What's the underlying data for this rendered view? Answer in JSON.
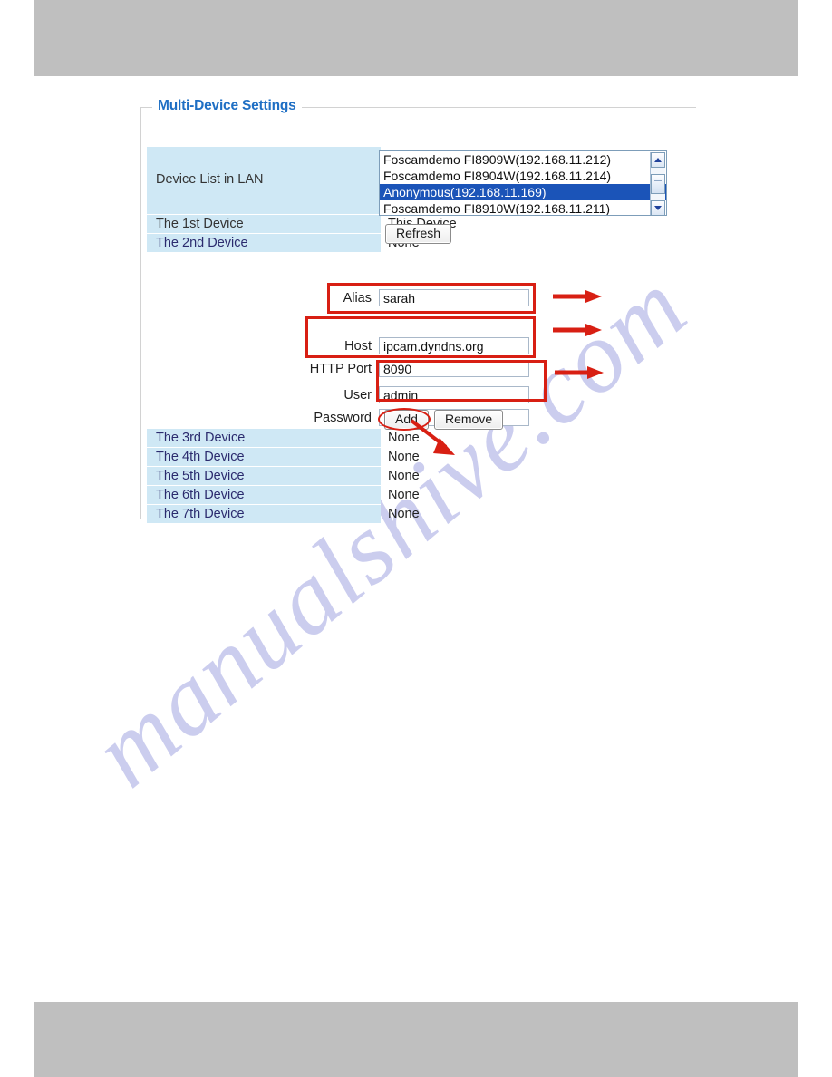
{
  "page": {
    "watermark": "manualshive.com",
    "bar_color": "#bfbfbf",
    "accent_color": "#1f6fc4",
    "annotation_color": "#d81f13",
    "row_color": "#cfe8f5"
  },
  "panel": {
    "legend": "Multi-Device Settings"
  },
  "device_list": {
    "label": "Device List in LAN",
    "options": [
      "Foscamdemo FI8909W(192.168.11.212)",
      "Foscamdemo FI8904W(192.168.11.214)",
      "Anonymous(192.168.11.169)",
      "Foscamdemo FI8910W(192.168.11.211)"
    ],
    "selected_index": 2,
    "scroll_up_icon": "chevron-up-icon",
    "scroll_down_icon": "chevron-down-icon",
    "refresh_label": "Refresh"
  },
  "devices": [
    {
      "label": "The 1st Device",
      "value": "This Device"
    },
    {
      "label": "The 2nd Device",
      "value": "None"
    },
    {
      "label": "The 3rd Device",
      "value": "None"
    },
    {
      "label": "The 4th Device",
      "value": "None"
    },
    {
      "label": "The 5th Device",
      "value": "None"
    },
    {
      "label": "The 6th Device",
      "value": "None"
    },
    {
      "label": "The 7th Device",
      "value": "None"
    }
  ],
  "form": {
    "alias": {
      "label": "Alias",
      "value": "sarah"
    },
    "host": {
      "label": "Host",
      "value": "ipcam.dyndns.org"
    },
    "http_port": {
      "label": "HTTP Port",
      "value": "8090"
    },
    "user": {
      "label": "User",
      "value": "admin"
    },
    "password": {
      "label": "Password",
      "value": "●●●"
    }
  },
  "actions": {
    "add_label": "Add",
    "remove_label": "Remove"
  }
}
